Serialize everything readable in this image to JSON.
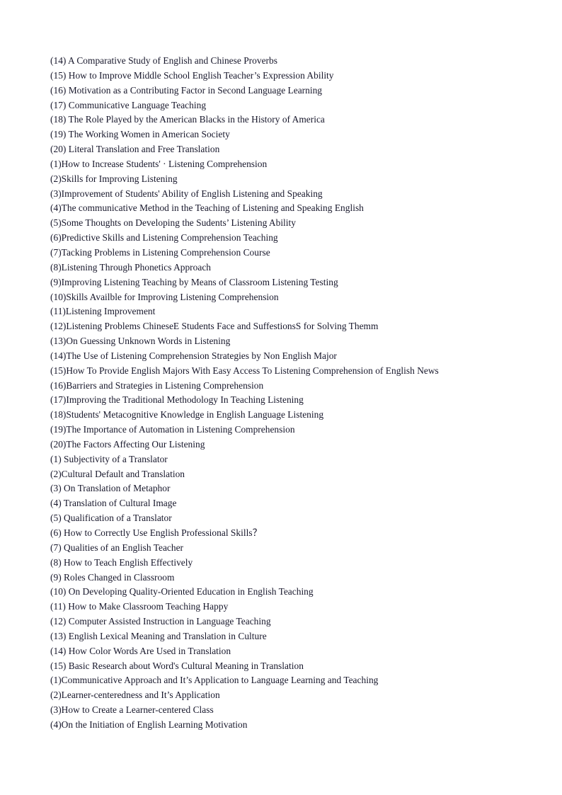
{
  "document": {
    "type": "thesis-topic-list",
    "page_background": "#ffffff",
    "text_color": "#17172b",
    "groups": [
      {
        "name": "general-topics",
        "lines": [
          "(14) A Comparative Study of English and Chinese Proverbs",
          "(15) How to Improve Middle School English Teacher’s Expression Ability",
          "(16) Motivation as a Contributing Factor in Second Language Learning",
          "(17) Communicative Language Teaching",
          "(18) The Role Played by the American Blacks in the History of America",
          "(19) The Working Women in American Society",
          "(20) Literal Translation and Free Translation"
        ]
      },
      {
        "name": "listening-topics",
        "lines": [
          "(1)How to Increase Students' · Listening Comprehension",
          "(2)Skills for Improving Listening",
          "(3)Improvement of Students' Ability of English Listening and Speaking",
          "(4)The communicative Method in the Teaching of Listening and Speaking English",
          "(5)Some Thoughts on Developing the Sudents’ Listening Ability",
          "(6)Predictive Skills and Listening Comprehension Teaching",
          "(7)Tacking Problems in Listening Comprehension Course",
          "(8)Listening Through Phonetics Approach",
          "(9)Improving Listening Teaching by Means of Classroom Listening Testing",
          "(10)Skills Availble for Improving Listening Comprehension",
          "(11)Listening Improvement",
          "(12)Listening Problems ChineseE Students Face and SuffestionsS for Solving Themm",
          "(13)On Guessing Unknown Words in Listening",
          "(14)The Use of Listening Comprehension Strategies by Non English Major",
          "(15)How To Provide English Majors With Easy Access To Listening Comprehension of English News",
          "(16)Barriers and Strategies in Listening Comprehension",
          "(17)Improving the Traditional Methodology In Teaching Listening",
          "(18)Students' Metacognitive Knowledge in English Language Listening",
          "(19)The Importance of Automation in Listening Comprehension",
          "(20)The Factors Affecting Our Listening"
        ]
      },
      {
        "name": "translation-and-teaching-topics",
        "lines": [
          "(1) Subjectivity of a Translator",
          "(2)Cultural Default and Translation",
          "(3) On Translation of Metaphor",
          "(4) Translation of Cultural Image",
          "(5) Qualification of a Translator",
          "(6) How to Correctly Use English Professional Skills？",
          "(7) Qualities of an English Teacher",
          "(8) How to Teach English Effectively",
          "(9) Roles Changed in Classroom",
          "(10) On Developing Quality-Oriented Education in English Teaching",
          "(11) How to Make Classroom Teaching Happy",
          "(12) Computer Assisted Instruction in Language Teaching",
          "(13) English Lexical Meaning and Translation in Culture",
          "(14) How Color Words Are Used in Translation",
          "(15) Basic Research about Word's Cultural Meaning in Translation"
        ]
      },
      {
        "name": "communicative-approach-topics",
        "lines": [
          "(1)Communicative Approach and It’s Application to Language Learning and Teaching",
          "(2)Learner-centeredness and It’s Application",
          "(3)How to Create a Learner-centered Class",
          "(4)On the Initiation of English Learning Motivation"
        ]
      }
    ]
  }
}
